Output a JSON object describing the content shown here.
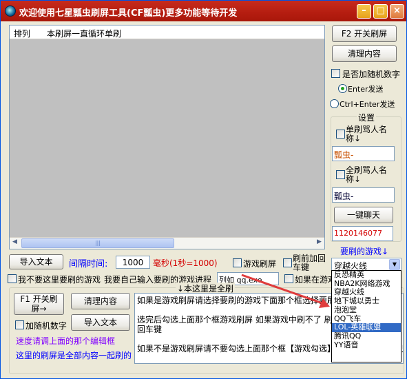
{
  "window": {
    "title": "欢迎使用七星瓢虫刷屏工具(CF瓢虫)更多功能等待开发"
  },
  "list": {
    "col_index": "排列",
    "col_mode": "本刷屏一直循环单刷"
  },
  "right": {
    "toggle_btn": "F2 开关刷屏",
    "clear_btn": "清理内容",
    "random_num": "是否加随机数字",
    "radio_enter": "Enter发送",
    "radio_ctrl": "Ctrl+Enter发送",
    "settings_title": "设置",
    "single_chk": "单刷骂人名称↓",
    "single_val": "瓢虫-",
    "multi_chk": "全刷骂人名称↓",
    "multi_val": "瓢虫-",
    "chat_btn": "一键聊天",
    "qq_val": "1120146077",
    "game_label": "要刷的游戏↓"
  },
  "mid": {
    "import_btn": "导入文本",
    "interval_label": "间隔时间:",
    "interval_val": "1000",
    "ms_label": "毫秒(1秒=1000)",
    "game_refresh": "游戏刷屏",
    "return_chk": "刷前加回车键",
    "no_game_chk": "我不要这里要刷的游戏",
    "input_hint": "我要自己输入要刷的游戏进程",
    "process_val": "列如 qq.exe",
    "in_game_chk": "如果在游戏",
    "full_label": "↓本这里是全刷"
  },
  "lower": {
    "toggle_btn": "F1 开关刷屏→",
    "clear_btn": "清理内容",
    "random_num": "加随机数字",
    "import_btn": "导入文本",
    "note1": "速度请调上面的那个编辑框",
    "note2": "这里的刷屏是全部内容一起刷的"
  },
  "memo": {
    "lines": [
      "如果是游戏刷屏请选择要刷的游戏下面那个框选择要刷的",
      "",
      "选完后勾选上面那个框游戏刷屏 如果游戏中刷不了 刷",
      "回车键",
      "",
      "如果不是游戏刷屏请不要勾选上面那个框【游戏勾选】部分游戏测试可以只"
    ]
  },
  "dropdown": {
    "selected": "穿越火线",
    "options": [
      "反恐精英",
      "NBA2K网络游戏",
      "穿越火线",
      "地下城以勇士",
      "泡泡堂",
      "QQ飞车",
      "LOL-英雄联盟",
      "腾讯QQ",
      "YY语音"
    ],
    "highlighted_index": 6
  },
  "colors": {
    "accent_red": "#d40000",
    "accent_blue": "#0000ff",
    "purple": "#8000ff",
    "arrow": "#e03c3c"
  }
}
